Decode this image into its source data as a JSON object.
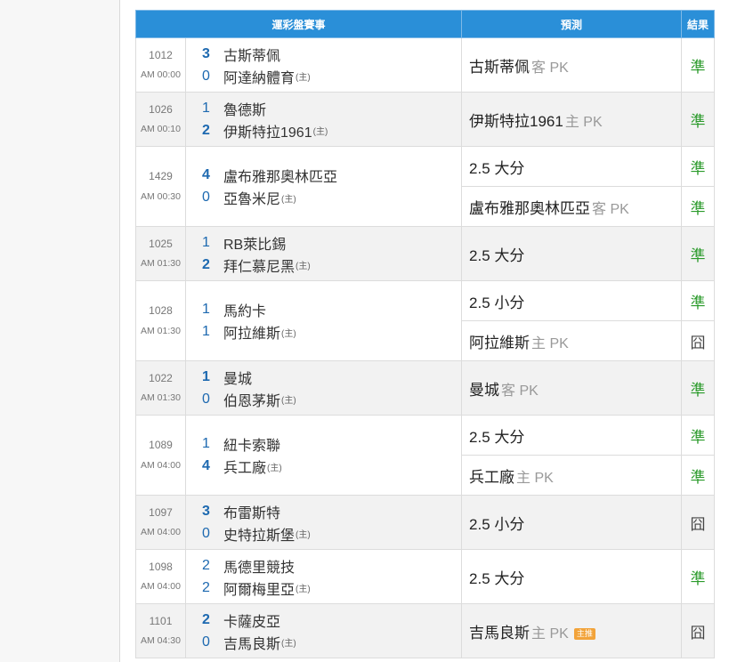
{
  "header": {
    "event": "運彩盤賽事",
    "prediction": "預測",
    "result": "結果"
  },
  "home_marker": "主",
  "matches": [
    {
      "code": "1012",
      "time": "AM 00:00",
      "away": {
        "score": "3",
        "name": "古斯蒂佩",
        "win": true
      },
      "home": {
        "score": "0",
        "name": "阿達納體育",
        "win": false
      },
      "preds": [
        {
          "text": "古斯蒂佩",
          "side": "客 PK",
          "result": "準",
          "ok": true
        }
      ]
    },
    {
      "code": "1026",
      "time": "AM 00:10",
      "away": {
        "score": "1",
        "name": "魯德斯",
        "win": false
      },
      "home": {
        "score": "2",
        "name": "伊斯特拉1961",
        "win": true
      },
      "preds": [
        {
          "text": "伊斯特拉1961",
          "side": "主 PK",
          "result": "準",
          "ok": true
        }
      ]
    },
    {
      "code": "1429",
      "time": "AM 00:30",
      "away": {
        "score": "4",
        "name": "盧布雅那奧林匹亞",
        "win": true
      },
      "home": {
        "score": "0",
        "name": "亞魯米尼",
        "win": false
      },
      "preds": [
        {
          "text": "2.5 大分",
          "side": "",
          "result": "準",
          "ok": true
        },
        {
          "text": "盧布雅那奧林匹亞",
          "side": "客 PK",
          "result": "準",
          "ok": true
        }
      ]
    },
    {
      "code": "1025",
      "time": "AM 01:30",
      "away": {
        "score": "1",
        "name": "RB萊比錫",
        "win": false
      },
      "home": {
        "score": "2",
        "name": "拜仁慕尼黑",
        "win": true
      },
      "preds": [
        {
          "text": "2.5 大分",
          "side": "",
          "result": "準",
          "ok": true
        }
      ]
    },
    {
      "code": "1028",
      "time": "AM 01:30",
      "away": {
        "score": "1",
        "name": "馬約卡",
        "win": false
      },
      "home": {
        "score": "1",
        "name": "阿拉維斯",
        "win": false
      },
      "preds": [
        {
          "text": "2.5 小分",
          "side": "",
          "result": "準",
          "ok": true
        },
        {
          "text": "阿拉維斯",
          "side": "主 PK",
          "result": "囧",
          "ok": false
        }
      ]
    },
    {
      "code": "1022",
      "time": "AM 01:30",
      "away": {
        "score": "1",
        "name": "曼城",
        "win": true
      },
      "home": {
        "score": "0",
        "name": "伯恩茅斯",
        "win": false
      },
      "preds": [
        {
          "text": "曼城",
          "side": "客 PK",
          "result": "準",
          "ok": true
        }
      ]
    },
    {
      "code": "1089",
      "time": "AM 04:00",
      "away": {
        "score": "1",
        "name": "紐卡索聯",
        "win": false
      },
      "home": {
        "score": "4",
        "name": "兵工廠",
        "win": true
      },
      "preds": [
        {
          "text": "2.5 大分",
          "side": "",
          "result": "準",
          "ok": true
        },
        {
          "text": "兵工廠",
          "side": "主 PK",
          "result": "準",
          "ok": true
        }
      ]
    },
    {
      "code": "1097",
      "time": "AM 04:00",
      "away": {
        "score": "3",
        "name": "布雷斯特",
        "win": true
      },
      "home": {
        "score": "0",
        "name": "史特拉斯堡",
        "win": false
      },
      "preds": [
        {
          "text": "2.5 小分",
          "side": "",
          "result": "囧",
          "ok": false
        }
      ]
    },
    {
      "code": "1098",
      "time": "AM 04:00",
      "away": {
        "score": "2",
        "name": "馬德里競技",
        "win": false
      },
      "home": {
        "score": "2",
        "name": "阿爾梅里亞",
        "win": false
      },
      "preds": [
        {
          "text": "2.5 大分",
          "side": "",
          "result": "準",
          "ok": true
        }
      ]
    },
    {
      "code": "1101",
      "time": "AM 04:30",
      "away": {
        "score": "2",
        "name": "卡薩皮亞",
        "win": true
      },
      "home": {
        "score": "0",
        "name": "吉馬良斯",
        "win": false
      },
      "preds": [
        {
          "text": "吉馬良斯",
          "side": "主 PK",
          "badge": "主推",
          "result": "囧",
          "ok": false
        }
      ]
    }
  ]
}
